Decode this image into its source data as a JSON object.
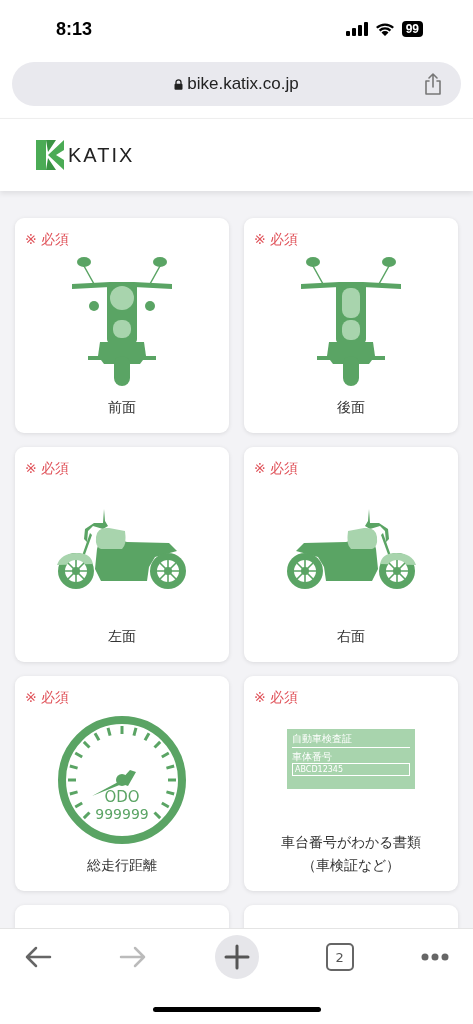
{
  "status_bar": {
    "time": "8:13",
    "battery": "99"
  },
  "address_bar": {
    "url": "bike.katix.co.jp"
  },
  "header": {
    "logo_text": "KATIX"
  },
  "cards": [
    {
      "kind": "bike_front",
      "required": "※ 必須",
      "label": "前面"
    },
    {
      "kind": "bike_rear",
      "required": "※ 必須",
      "label": "後面"
    },
    {
      "kind": "bike_left",
      "required": "※ 必須",
      "label": "左面"
    },
    {
      "kind": "bike_right",
      "required": "※ 必須",
      "label": "右面"
    },
    {
      "kind": "odometer",
      "required": "※ 必須",
      "label": "総走行距離",
      "odo_title": "ODO",
      "odo_value": "999999"
    },
    {
      "kind": "document",
      "required": "※ 必須",
      "label": "車台番号がわかる書類（車検証など）",
      "doc_title": "自動車検査証",
      "doc_field_label": "車体番号",
      "doc_field_value": "ABCD12345"
    },
    {
      "kind": "blank"
    },
    {
      "kind": "blank"
    }
  ],
  "toolbar": {
    "tab_count": "2"
  }
}
